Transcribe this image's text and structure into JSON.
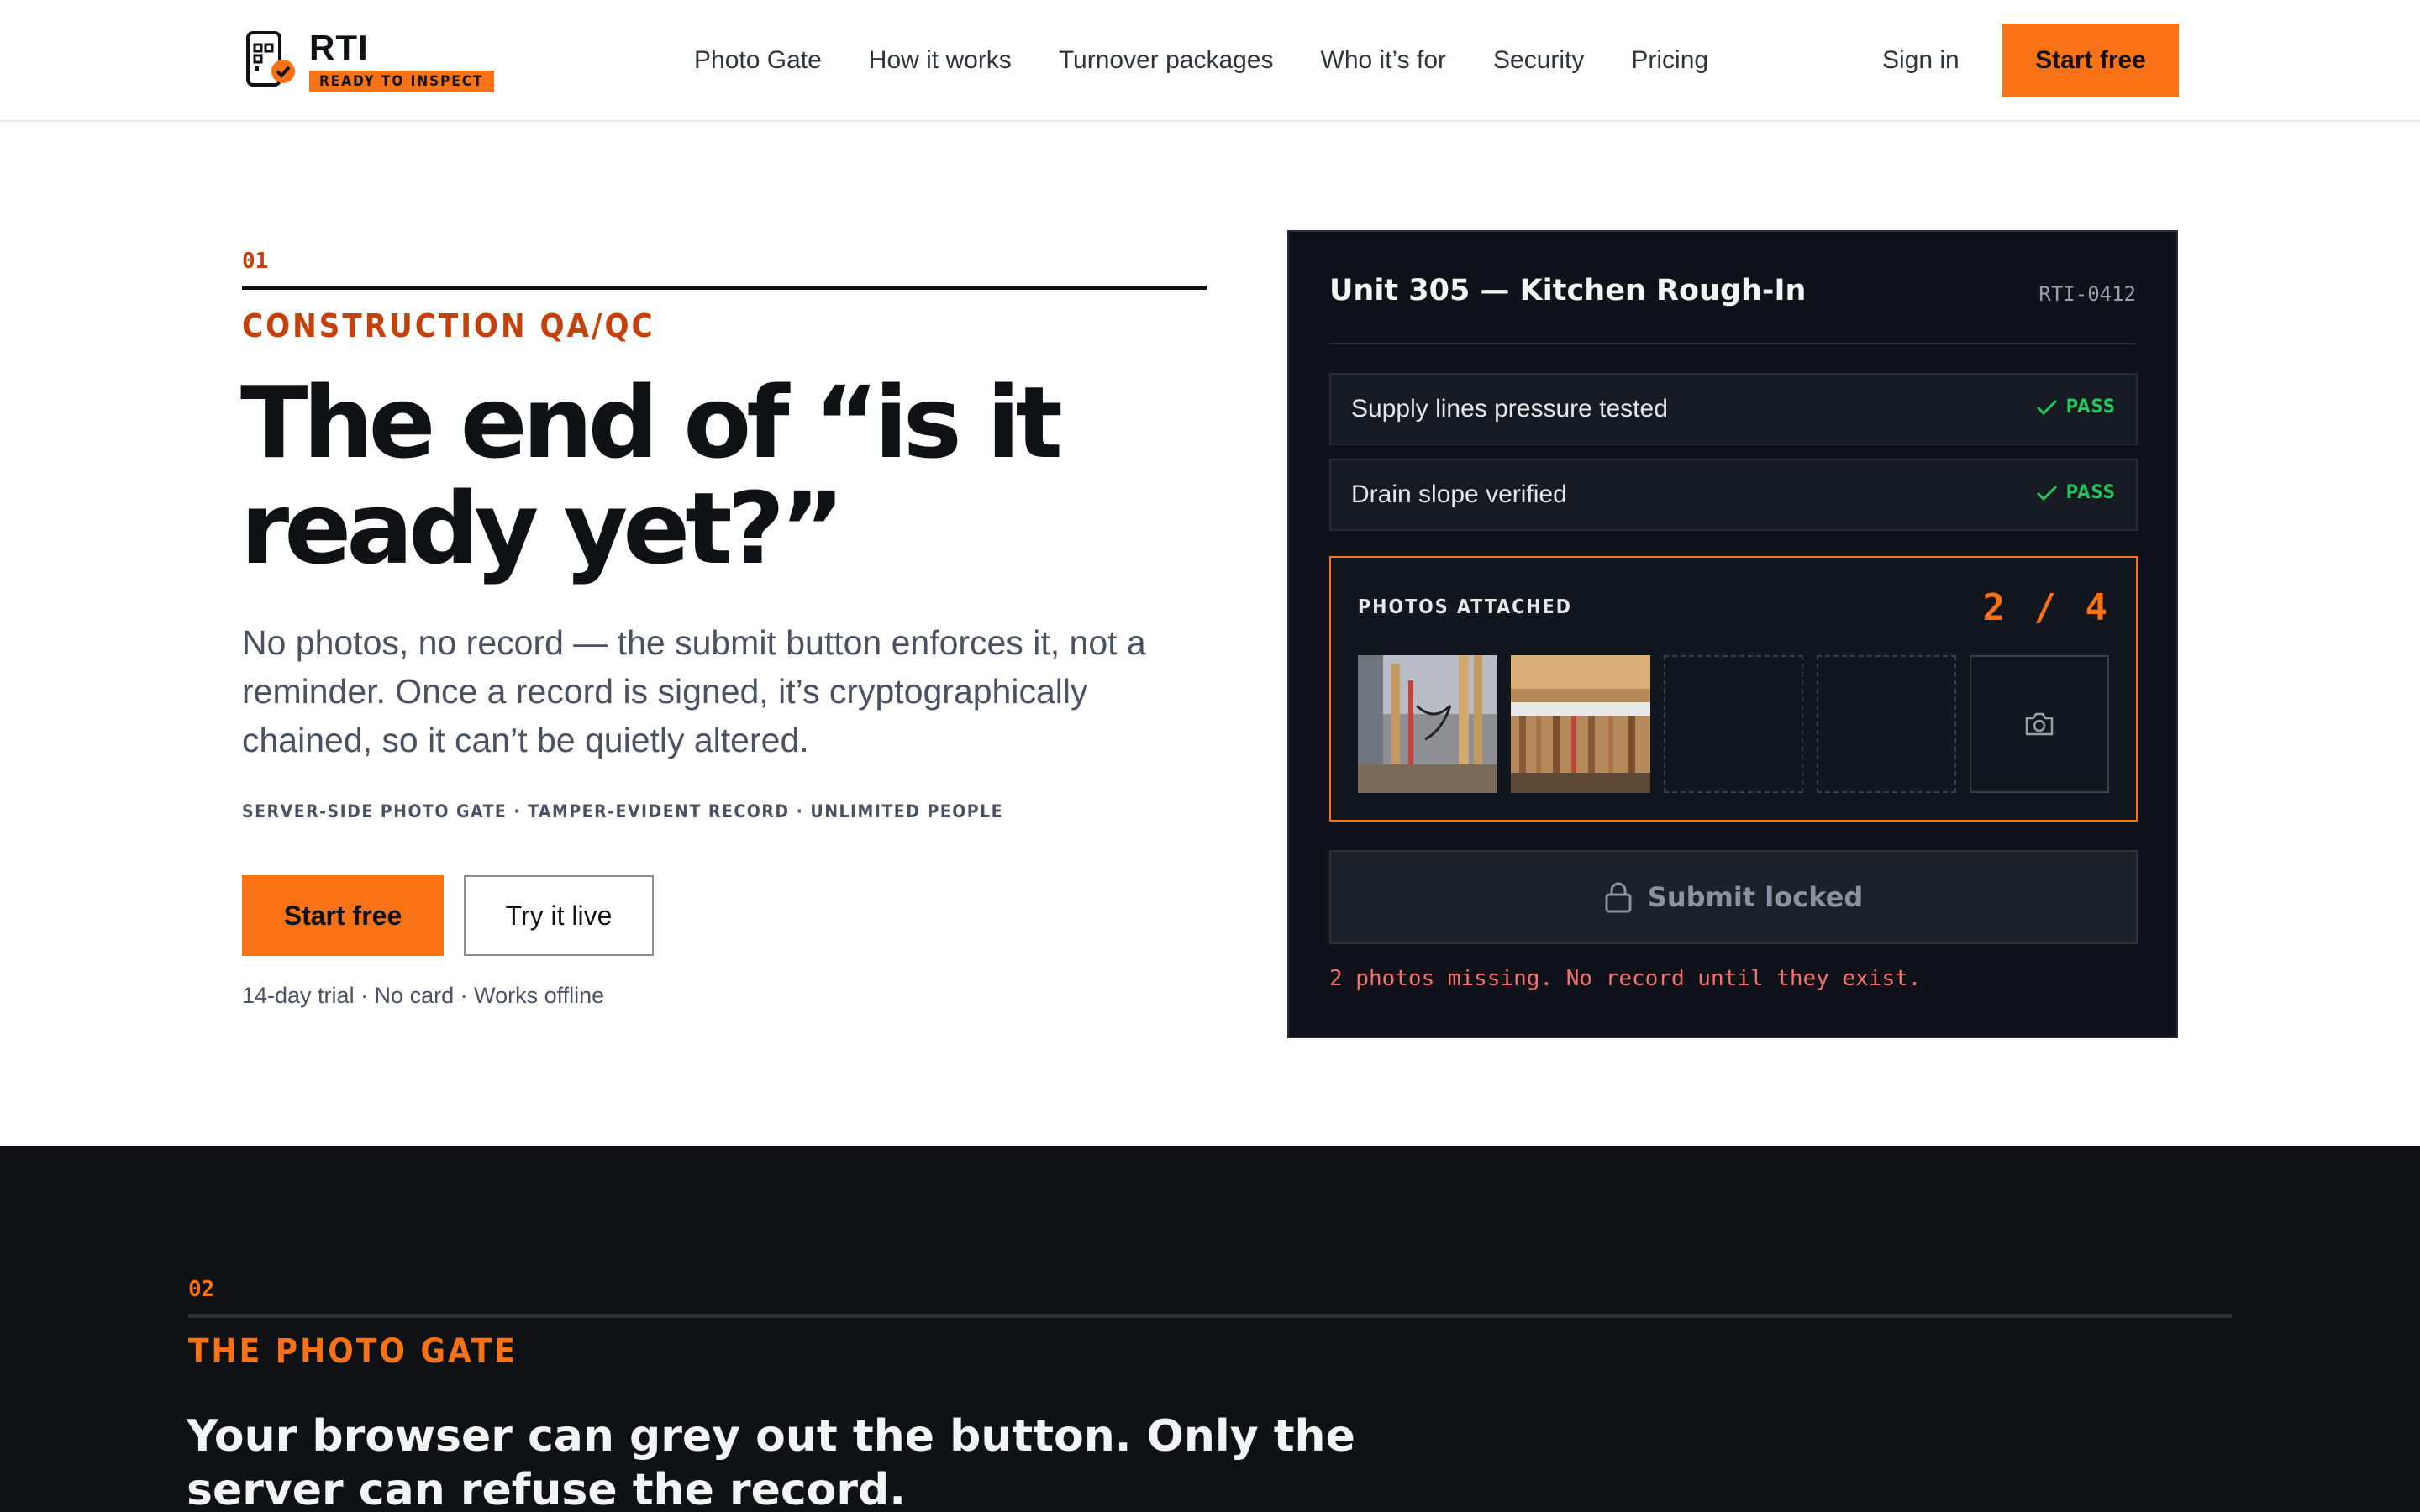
{
  "brand": {
    "name": "RTI",
    "tagline": "READY TO INSPECT",
    "accent": "#f97316"
  },
  "nav": {
    "items": [
      "Photo Gate",
      "How it works",
      "Turnover packages",
      "Who it’s for",
      "Security",
      "Pricing"
    ],
    "signin": "Sign in",
    "cta": "Start free"
  },
  "hero": {
    "section_number": "01",
    "kicker": "CONSTRUCTION QA/QC",
    "headline_line1": "The end of “is it",
    "headline_line2": "ready yet?”",
    "lede": "No photos, no record — the submit button enforces it, not a reminder. Once a record is signed, it’s cryptographically chained, so it can’t be quietly altered.",
    "tags": "SERVER-SIDE PHOTO GATE · TAMPER-EVIDENT RECORD · UNLIMITED PEOPLE",
    "primary_cta": "Start free",
    "secondary_cta": "Try it live",
    "fine_print": "14-day trial · No card · Works offline"
  },
  "card": {
    "title": "Unit 305 — Kitchen Rough-In",
    "record_id": "RTI-0412",
    "checks": [
      {
        "label": "Supply lines pressure tested",
        "status": "PASS"
      },
      {
        "label": "Drain slope verified",
        "status": "PASS"
      }
    ],
    "photos_label": "PHOTOS ATTACHED",
    "photos_count": "2 / 4",
    "submit_label": "Submit locked",
    "warning": "2 photos missing. No record until they exist."
  },
  "section2": {
    "section_number": "02",
    "kicker": "THE PHOTO GATE",
    "headline": "Your browser can grey out the button. Only the server can refuse the record."
  }
}
